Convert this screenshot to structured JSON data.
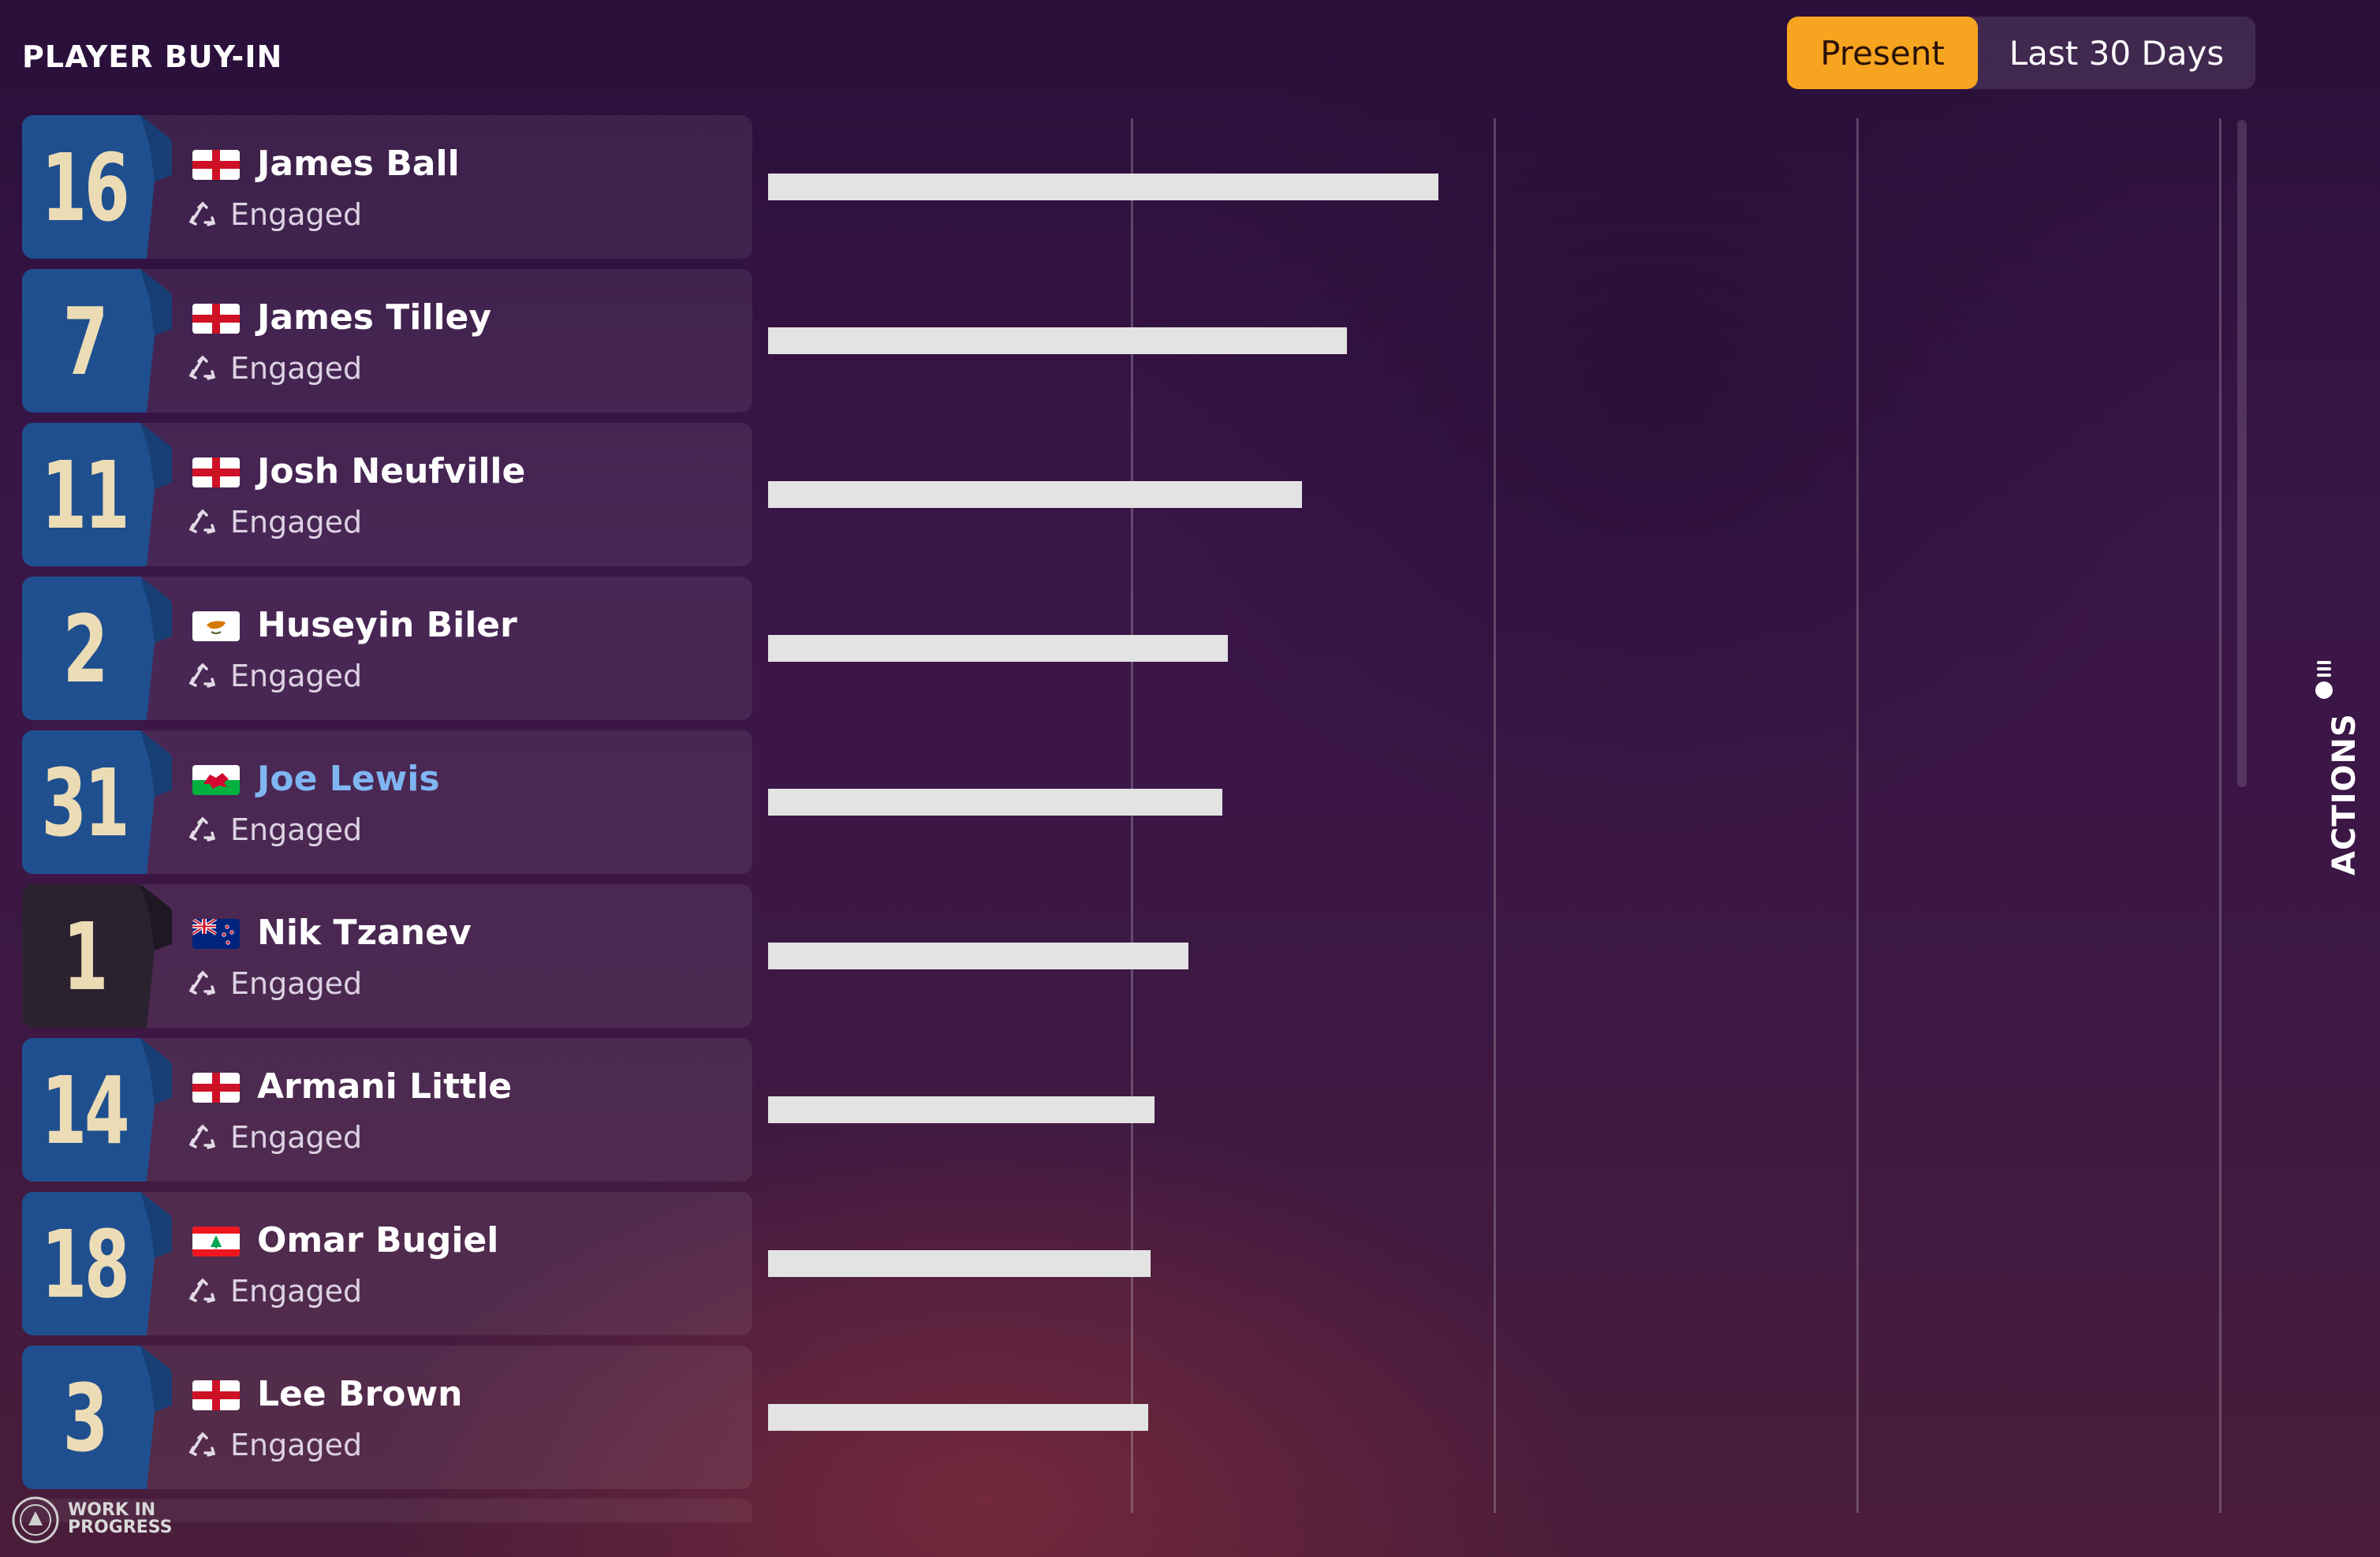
{
  "header": {
    "title": "PLAYER BUY-IN"
  },
  "toggle": {
    "options": [
      "Present",
      "Last 30 Days"
    ],
    "selected": "Present"
  },
  "side_panel": {
    "label": "ACTIONS"
  },
  "watermark": {
    "line1": "WORK IN",
    "line2": "PROGRESS"
  },
  "colors": {
    "accent": "#f7a520",
    "home_shirt": "#1f4f8f",
    "gk_shirt": "#2b2230",
    "highlight_name": "#7fb6f2",
    "bar": "#e3e3e3"
  },
  "players": [
    {
      "number": "16",
      "name": "James Ball",
      "nation": "england",
      "status": "Engaged",
      "status_icon": "recycle-icon",
      "shirt": "home",
      "highlighted": false,
      "buy_in": 0.59
    },
    {
      "number": "7",
      "name": "James Tilley",
      "nation": "england",
      "status": "Engaged",
      "status_icon": "recycle-icon",
      "shirt": "home",
      "highlighted": false,
      "buy_in": 0.51
    },
    {
      "number": "11",
      "name": "Josh Neufville",
      "nation": "england",
      "status": "Engaged",
      "status_icon": "recycle-icon",
      "shirt": "home",
      "highlighted": false,
      "buy_in": 0.47
    },
    {
      "number": "2",
      "name": "Huseyin Biler",
      "nation": "cyprus",
      "status": "Engaged",
      "status_icon": "recycle-icon",
      "shirt": "home",
      "highlighted": false,
      "buy_in": 0.405
    },
    {
      "number": "31",
      "name": "Joe Lewis",
      "nation": "wales",
      "status": "Engaged",
      "status_icon": "recycle-icon",
      "shirt": "home",
      "highlighted": true,
      "buy_in": 0.4
    },
    {
      "number": "1",
      "name": "Nik Tzanev",
      "nation": "new-zealand",
      "status": "Engaged",
      "status_icon": "recycle-icon",
      "shirt": "gk",
      "highlighted": false,
      "buy_in": 0.37
    },
    {
      "number": "14",
      "name": "Armani Little",
      "nation": "england",
      "status": "Engaged",
      "status_icon": "recycle-icon",
      "shirt": "home",
      "highlighted": false,
      "buy_in": 0.34
    },
    {
      "number": "18",
      "name": "Omar Bugiel",
      "nation": "lebanon",
      "status": "Engaged",
      "status_icon": "recycle-icon",
      "shirt": "home",
      "highlighted": false,
      "buy_in": 0.337
    },
    {
      "number": "3",
      "name": "Lee Brown",
      "nation": "england",
      "status": "Engaged",
      "status_icon": "recycle-icon",
      "shirt": "home",
      "highlighted": false,
      "buy_in": 0.335
    }
  ]
}
